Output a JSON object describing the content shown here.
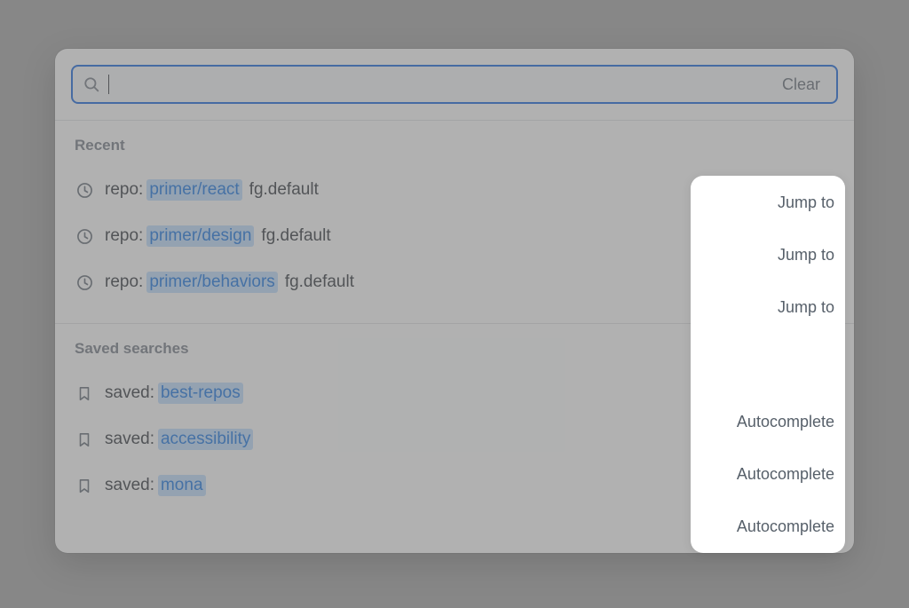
{
  "search": {
    "value": "",
    "placeholder": "",
    "clear_label": "Clear"
  },
  "sections": {
    "recent": {
      "header": "Recent",
      "action": "Jump to",
      "items": [
        {
          "prefix": "repo:",
          "highlight": "primer/react",
          "suffix": "fg.default"
        },
        {
          "prefix": "repo:",
          "highlight": "primer/design",
          "suffix": "fg.default"
        },
        {
          "prefix": "repo:",
          "highlight": "primer/behaviors",
          "suffix": "fg.default"
        }
      ]
    },
    "saved": {
      "header": "Saved searches",
      "action": "Autocomplete",
      "items": [
        {
          "prefix": "saved:",
          "highlight": "best-repos",
          "suffix": ""
        },
        {
          "prefix": "saved:",
          "highlight": "accessibility",
          "suffix": ""
        },
        {
          "prefix": "saved:",
          "highlight": "mona",
          "suffix": ""
        }
      ]
    }
  }
}
